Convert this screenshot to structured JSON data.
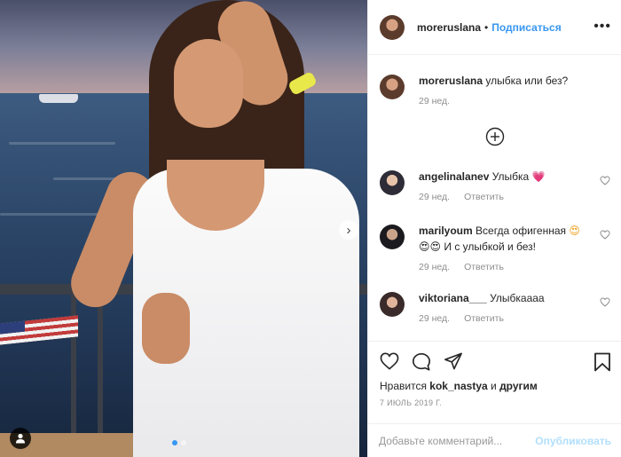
{
  "post": {
    "author": "moreruslana",
    "separator": "•",
    "follow_label": "Подписаться",
    "more_icon": "more-options-icon"
  },
  "caption": {
    "username": "moreruslana",
    "text": "улыбка или без?",
    "time": "29 нед."
  },
  "load_more_icon": "plus-circle-icon",
  "comments": [
    {
      "username": "angelinalanev",
      "text": "Улыбка",
      "emoji": "💗",
      "time": "29 нед.",
      "reply_label": "Ответить"
    },
    {
      "username": "marilyoum",
      "text": "Всегда офигенная",
      "emoji": "😍",
      "text2": "😍😍 И с улыбкой и без!",
      "time": "29 нед.",
      "reply_label": "Ответить"
    },
    {
      "username": "viktoriana___",
      "text": "Улыбкаааа",
      "time": "29 нед.",
      "reply_label": "Ответить"
    }
  ],
  "likes": {
    "prefix": "Нравится",
    "user": "kok_nastya",
    "middle": "и",
    "suffix": "другим"
  },
  "date": "7 ИЮЛЬ 2019 Г.",
  "comment_input": {
    "placeholder": "Добавьте комментарий...",
    "publish_label": "Опубликовать"
  },
  "carousel": {
    "slide_count": 2,
    "active_slide": 1
  },
  "colors": {
    "accent": "#3897f0",
    "publish_disabled": "#b2dffc",
    "muted": "#8e8e8e"
  }
}
